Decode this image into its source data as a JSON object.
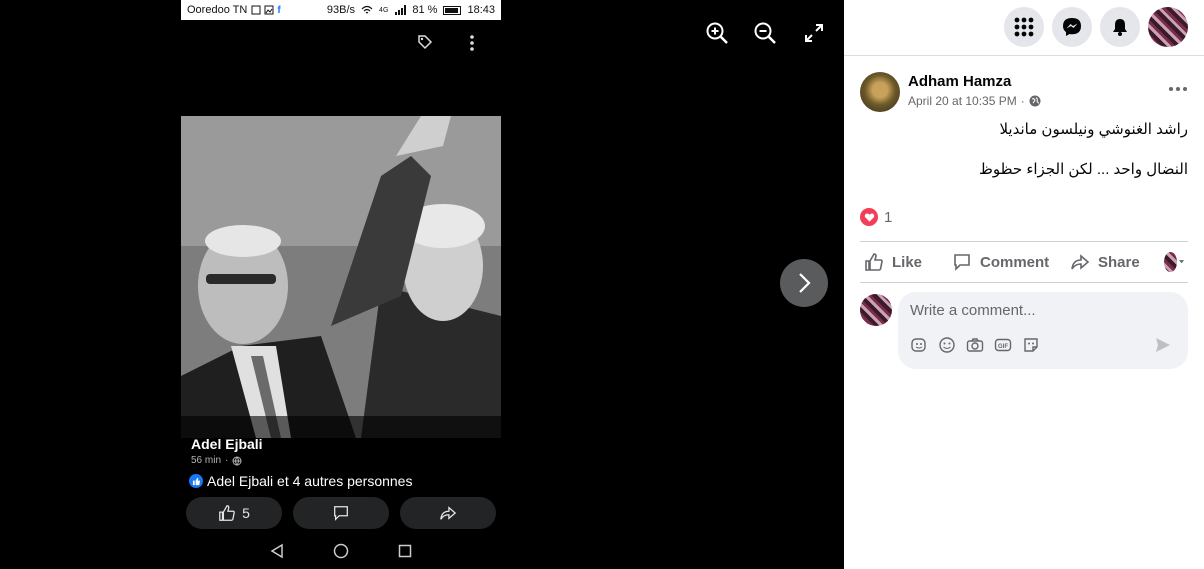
{
  "phone": {
    "status": {
      "carrier": "Ooredoo TN",
      "speed": "93B/s",
      "network": "4G",
      "battery": "81 %",
      "time": "18:43"
    },
    "author": "Adel Ejbali",
    "time": "56 min",
    "reactions_text": "Adel Ejbali et 4 autres personnes",
    "like_count": "5"
  },
  "post": {
    "author": "Adham Hamza",
    "timestamp": "April 20 at 10:35 PM",
    "line1": "راشد الغنوشي ونيلسون مانديلا",
    "line2": "النضال واحد ... لكن الجزاء حظوظ",
    "reaction_count": "1"
  },
  "actions": {
    "like": "Like",
    "comment": "Comment",
    "share": "Share"
  },
  "comment": {
    "placeholder": "Write a comment..."
  },
  "colors": {
    "fb_blue": "#1877f2",
    "love_red": "#f33e58",
    "panel_bg": "#ffffff",
    "viewer_bg": "#000000"
  }
}
